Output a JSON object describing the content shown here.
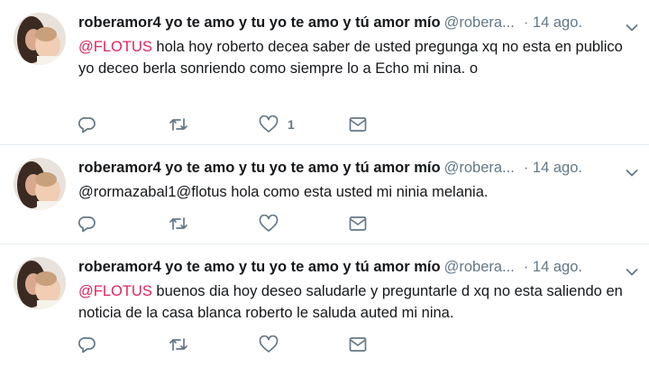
{
  "tweets": [
    {
      "author": "roberamor4 yo te amo y tu yo te amo y tú amor mío",
      "handle": "@robera...",
      "separator": "·",
      "time": "14 ago.",
      "mention": "@FLOTUS",
      "text": " hola hoy roberto decea saber de usted pregunga xq no esta en publico yo deceo berla sonriendo como siempre lo a Echo mi  nina. o",
      "like_count": "1"
    },
    {
      "author": "roberamor4 yo te amo y tu yo te amo y tú amor mío",
      "handle": "@robera...",
      "separator": "·",
      "time": "14 ago.",
      "mention": "",
      "text": "@rormazabal1@flotus hola como esta usted mi ninia melania.",
      "like_count": ""
    },
    {
      "author": "roberamor4 yo te amo y tu yo te amo y tú amor mío",
      "handle": "@robera...",
      "separator": "·",
      "time": "14 ago.",
      "mention": "@FLOTUS",
      "text": " buenos dia hoy deseo saludarle y preguntarle d xq no esta saliendo en noticia de la casa blanca roberto le saluda auted mi nina.",
      "like_count": ""
    }
  ],
  "icons": {
    "reply": "reply-icon",
    "retweet": "retweet-icon",
    "like": "heart-icon",
    "message": "envelope-icon",
    "menu": "chevron-down-icon"
  },
  "colors": {
    "text": "#14171a",
    "muted": "#657786",
    "mention": "#e0245e",
    "divider": "#e6ecf0"
  }
}
